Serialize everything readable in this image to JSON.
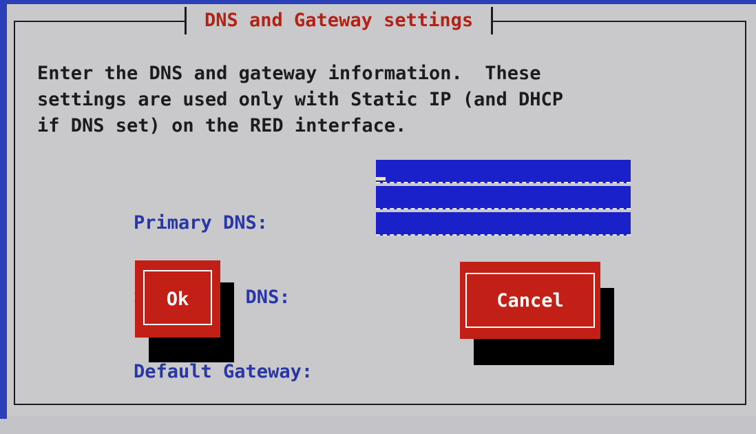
{
  "dialog": {
    "title": "DNS and Gateway settings",
    "intro": "Enter the DNS and gateway information.  These\nsettings are used only with Static IP (and DHCP\nif DNS set) on the RED interface."
  },
  "form": {
    "primary_dns": {
      "label": "Primary DNS:",
      "value": ""
    },
    "secondary_dns": {
      "label": "Secondary DNS:",
      "value": ""
    },
    "default_gateway": {
      "label": "Default Gateway:",
      "value": ""
    }
  },
  "buttons": {
    "ok_label": "Ok",
    "cancel_label": "Cancel"
  },
  "colors": {
    "dialog_bg": "#c9c9cc",
    "title_text": "#b32215",
    "label_text": "#2936a6",
    "field_bg": "#1a21c8",
    "button_bg": "#c21f16",
    "screen_bg": "#2a3fb8"
  }
}
